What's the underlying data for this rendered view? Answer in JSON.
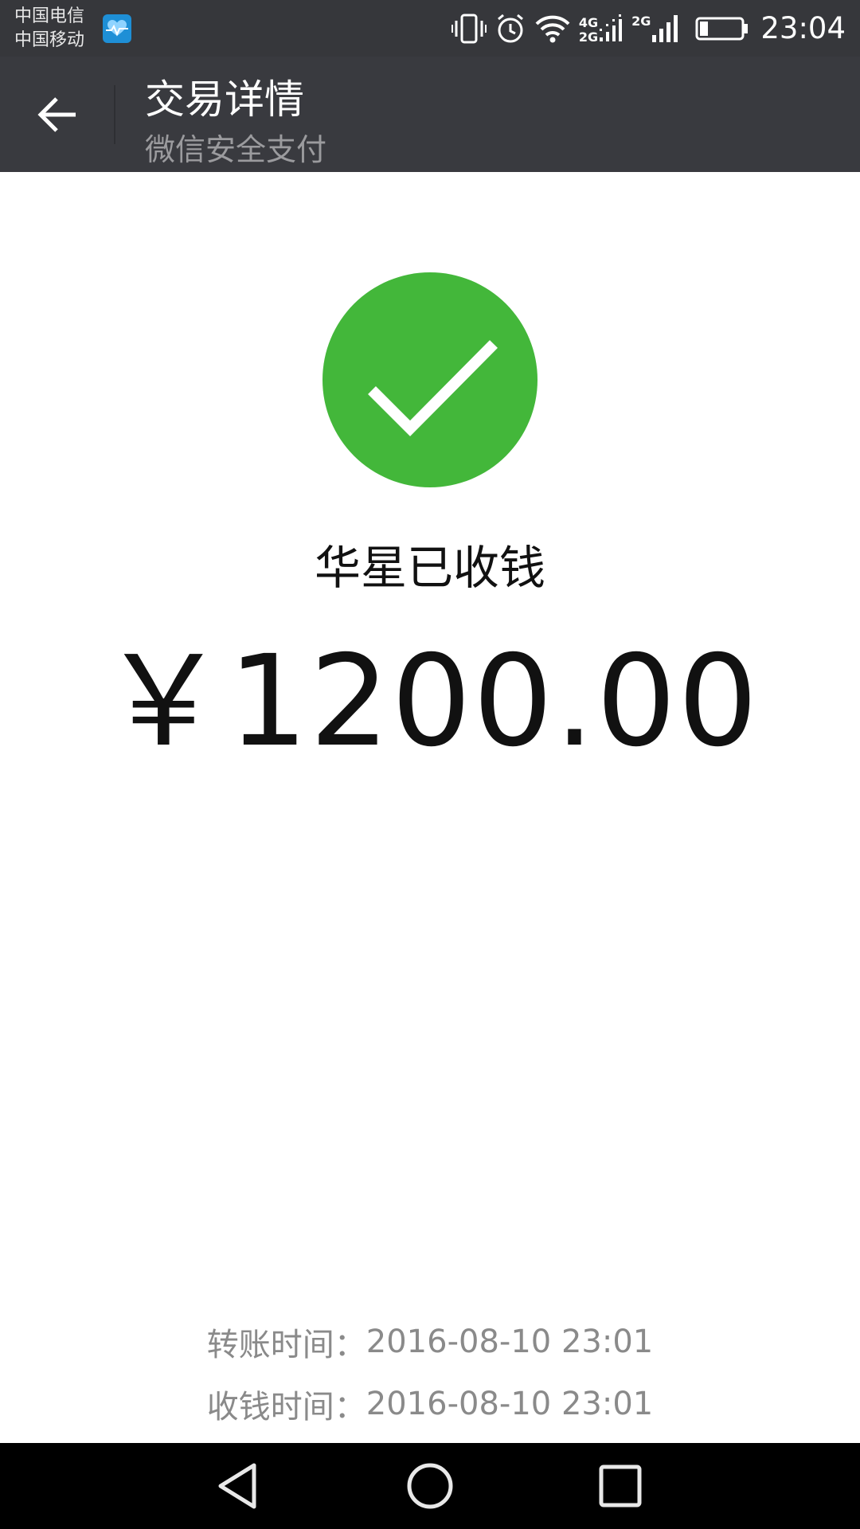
{
  "status_bar": {
    "carrier_1": "中国电信",
    "carrier_2": "中国移动",
    "notification_icon": "health-heart-icon",
    "icons": [
      "vibrate-icon",
      "alarm-icon",
      "wifi-icon",
      "signal-4g-icon",
      "signal-2g-icon",
      "battery-icon"
    ],
    "net_label_top_1": "4G",
    "net_label_bottom_1": "2G",
    "net_label_2": "2G",
    "battery_level": 0.2,
    "time": "23:04"
  },
  "header": {
    "back_icon": "back-arrow-icon",
    "title": "交易详情",
    "subtitle": "微信安全支付"
  },
  "result": {
    "icon": "success-check-icon",
    "icon_color": "#43b73a",
    "status_text": "华星已收钱",
    "amount": "￥1200.00"
  },
  "details": {
    "transfer_time_label": "转账时间：",
    "transfer_time_value": "2016-08-10 23:01",
    "receive_time_label": "收钱时间：",
    "receive_time_value": "2016-08-10 23:01"
  },
  "nav": {
    "back": "nav-back-icon",
    "home": "nav-home-icon",
    "recents": "nav-recents-icon"
  }
}
